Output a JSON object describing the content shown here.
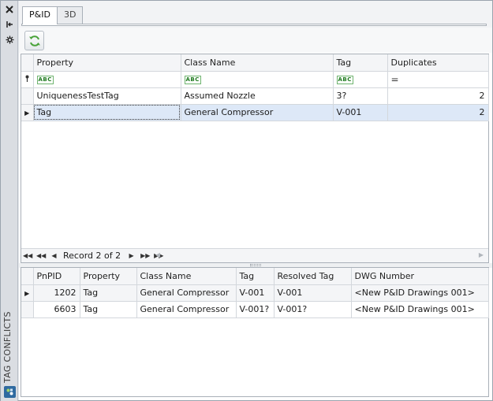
{
  "panel": {
    "title": "TAG CONFLICTS"
  },
  "tabs": [
    {
      "label": "P&ID",
      "active": true
    },
    {
      "label": "3D",
      "active": false
    }
  ],
  "upper_grid": {
    "columns": [
      "Property",
      "Class Name",
      "Tag",
      "Duplicates"
    ],
    "rows": [
      {
        "property": "UniquenessTestTag",
        "class_name": "Assumed Nozzle",
        "tag": "3?",
        "duplicates": "2"
      },
      {
        "property": "Tag",
        "class_name": "General Compressor",
        "tag": "V-001",
        "duplicates": "2"
      }
    ],
    "filter_icon": "abc-filter-icon",
    "duplicates_filter": "="
  },
  "navigator": {
    "record_text": "Record 2 of 2"
  },
  "lower_grid": {
    "columns": [
      "PnPID",
      "Property",
      "Class Name",
      "Tag",
      "Resolved Tag",
      "DWG Number"
    ],
    "rows": [
      {
        "pnpid": "1202",
        "property": "Tag",
        "class_name": "General Compressor",
        "tag": "V-001",
        "resolved_tag": "V-001",
        "dwg_number": "<New P&ID Drawings 001>"
      },
      {
        "pnpid": "6603",
        "property": "Tag",
        "class_name": "General Compressor",
        "tag": "V-001?",
        "resolved_tag": "V-001?",
        "dwg_number": "<New P&ID Drawings 001>"
      }
    ]
  },
  "colors": {
    "selected_row": "#dde8f7",
    "accent": "#2f6aa0"
  }
}
